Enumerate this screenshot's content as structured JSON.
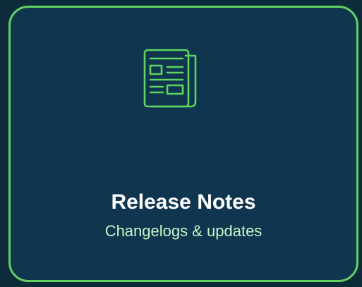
{
  "card": {
    "title": "Release Notes",
    "subtitle": "Changelogs & updates",
    "icon": "newspaper-icon"
  },
  "colors": {
    "accent": "#5fd35f",
    "card_background": "#10364f",
    "page_background": "#0e2b3c",
    "title_text": "#ffffff",
    "subtitle_text": "#c9f5c9"
  }
}
